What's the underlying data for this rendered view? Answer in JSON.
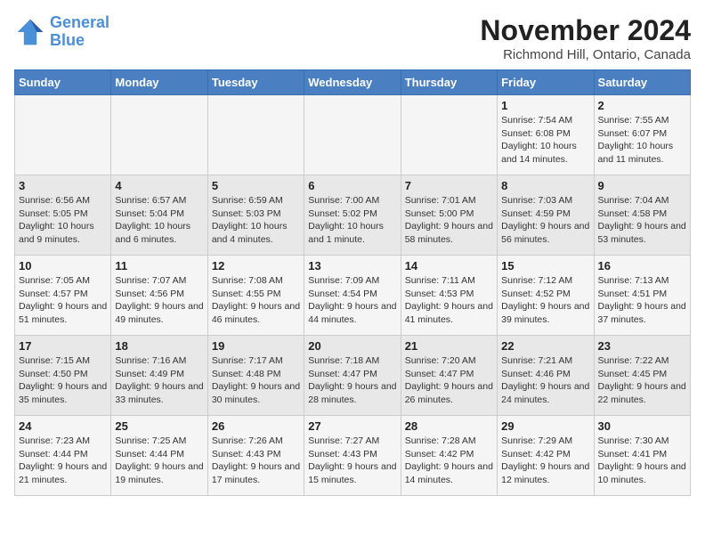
{
  "header": {
    "logo_line1": "General",
    "logo_line2": "Blue",
    "month": "November 2024",
    "location": "Richmond Hill, Ontario, Canada"
  },
  "weekdays": [
    "Sunday",
    "Monday",
    "Tuesday",
    "Wednesday",
    "Thursday",
    "Friday",
    "Saturday"
  ],
  "weeks": [
    [
      {
        "day": "",
        "info": ""
      },
      {
        "day": "",
        "info": ""
      },
      {
        "day": "",
        "info": ""
      },
      {
        "day": "",
        "info": ""
      },
      {
        "day": "",
        "info": ""
      },
      {
        "day": "1",
        "info": "Sunrise: 7:54 AM\nSunset: 6:08 PM\nDaylight: 10 hours and 14 minutes."
      },
      {
        "day": "2",
        "info": "Sunrise: 7:55 AM\nSunset: 6:07 PM\nDaylight: 10 hours and 11 minutes."
      }
    ],
    [
      {
        "day": "3",
        "info": "Sunrise: 6:56 AM\nSunset: 5:05 PM\nDaylight: 10 hours and 9 minutes."
      },
      {
        "day": "4",
        "info": "Sunrise: 6:57 AM\nSunset: 5:04 PM\nDaylight: 10 hours and 6 minutes."
      },
      {
        "day": "5",
        "info": "Sunrise: 6:59 AM\nSunset: 5:03 PM\nDaylight: 10 hours and 4 minutes."
      },
      {
        "day": "6",
        "info": "Sunrise: 7:00 AM\nSunset: 5:02 PM\nDaylight: 10 hours and 1 minute."
      },
      {
        "day": "7",
        "info": "Sunrise: 7:01 AM\nSunset: 5:00 PM\nDaylight: 9 hours and 58 minutes."
      },
      {
        "day": "8",
        "info": "Sunrise: 7:03 AM\nSunset: 4:59 PM\nDaylight: 9 hours and 56 minutes."
      },
      {
        "day": "9",
        "info": "Sunrise: 7:04 AM\nSunset: 4:58 PM\nDaylight: 9 hours and 53 minutes."
      }
    ],
    [
      {
        "day": "10",
        "info": "Sunrise: 7:05 AM\nSunset: 4:57 PM\nDaylight: 9 hours and 51 minutes."
      },
      {
        "day": "11",
        "info": "Sunrise: 7:07 AM\nSunset: 4:56 PM\nDaylight: 9 hours and 49 minutes."
      },
      {
        "day": "12",
        "info": "Sunrise: 7:08 AM\nSunset: 4:55 PM\nDaylight: 9 hours and 46 minutes."
      },
      {
        "day": "13",
        "info": "Sunrise: 7:09 AM\nSunset: 4:54 PM\nDaylight: 9 hours and 44 minutes."
      },
      {
        "day": "14",
        "info": "Sunrise: 7:11 AM\nSunset: 4:53 PM\nDaylight: 9 hours and 41 minutes."
      },
      {
        "day": "15",
        "info": "Sunrise: 7:12 AM\nSunset: 4:52 PM\nDaylight: 9 hours and 39 minutes."
      },
      {
        "day": "16",
        "info": "Sunrise: 7:13 AM\nSunset: 4:51 PM\nDaylight: 9 hours and 37 minutes."
      }
    ],
    [
      {
        "day": "17",
        "info": "Sunrise: 7:15 AM\nSunset: 4:50 PM\nDaylight: 9 hours and 35 minutes."
      },
      {
        "day": "18",
        "info": "Sunrise: 7:16 AM\nSunset: 4:49 PM\nDaylight: 9 hours and 33 minutes."
      },
      {
        "day": "19",
        "info": "Sunrise: 7:17 AM\nSunset: 4:48 PM\nDaylight: 9 hours and 30 minutes."
      },
      {
        "day": "20",
        "info": "Sunrise: 7:18 AM\nSunset: 4:47 PM\nDaylight: 9 hours and 28 minutes."
      },
      {
        "day": "21",
        "info": "Sunrise: 7:20 AM\nSunset: 4:47 PM\nDaylight: 9 hours and 26 minutes."
      },
      {
        "day": "22",
        "info": "Sunrise: 7:21 AM\nSunset: 4:46 PM\nDaylight: 9 hours and 24 minutes."
      },
      {
        "day": "23",
        "info": "Sunrise: 7:22 AM\nSunset: 4:45 PM\nDaylight: 9 hours and 22 minutes."
      }
    ],
    [
      {
        "day": "24",
        "info": "Sunrise: 7:23 AM\nSunset: 4:44 PM\nDaylight: 9 hours and 21 minutes."
      },
      {
        "day": "25",
        "info": "Sunrise: 7:25 AM\nSunset: 4:44 PM\nDaylight: 9 hours and 19 minutes."
      },
      {
        "day": "26",
        "info": "Sunrise: 7:26 AM\nSunset: 4:43 PM\nDaylight: 9 hours and 17 minutes."
      },
      {
        "day": "27",
        "info": "Sunrise: 7:27 AM\nSunset: 4:43 PM\nDaylight: 9 hours and 15 minutes."
      },
      {
        "day": "28",
        "info": "Sunrise: 7:28 AM\nSunset: 4:42 PM\nDaylight: 9 hours and 14 minutes."
      },
      {
        "day": "29",
        "info": "Sunrise: 7:29 AM\nSunset: 4:42 PM\nDaylight: 9 hours and 12 minutes."
      },
      {
        "day": "30",
        "info": "Sunrise: 7:30 AM\nSunset: 4:41 PM\nDaylight: 9 hours and 10 minutes."
      }
    ]
  ]
}
